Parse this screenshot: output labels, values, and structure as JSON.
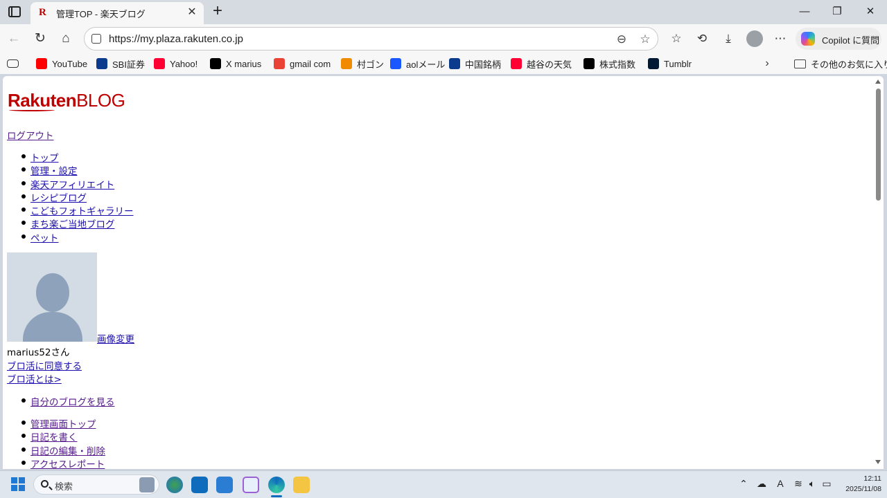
{
  "browser": {
    "tab_title": "管理TOP - 楽天ブログ",
    "tab_favicon": "R",
    "url": "https://my.plaza.rakuten.co.jp",
    "copilot_label": "Copilot に質問"
  },
  "favorites": [
    {
      "label": "YouTube",
      "icon": "youtube-icon",
      "color": "#ff0000"
    },
    {
      "label": "SBI証券",
      "icon": "sbi-icon",
      "color": "#0a3b8c"
    },
    {
      "label": "Yahoo!",
      "icon": "yahoo-icon",
      "color": "#ff0033"
    },
    {
      "label": "X marius",
      "icon": "x-icon",
      "color": "#000000"
    },
    {
      "label": "gmail com",
      "icon": "gmail-icon",
      "color": "#ea4335"
    },
    {
      "label": "村ゴン",
      "icon": "mura-icon",
      "color": "#f08a00"
    },
    {
      "label": "aolメール",
      "icon": "aol-icon",
      "color": "#1a57ff"
    },
    {
      "label": "中国銘柄",
      "icon": "chugoku-icon",
      "color": "#0a3b8c"
    },
    {
      "label": "越谷の天気",
      "icon": "yahoo-icon",
      "color": "#ff0033"
    },
    {
      "label": "株式指数",
      "icon": "b-icon",
      "color": "#000000"
    },
    {
      "label": "Tumblr",
      "icon": "tumblr-icon",
      "color": "#001935"
    }
  ],
  "favorites_folder": "その他のお気に入り",
  "page": {
    "logo_rakuten": "Rakuten",
    "logo_blog": "BLOG",
    "logout": "ログアウト",
    "nav": [
      "トップ",
      "管理・設定",
      "楽天アフィリエイト",
      "レシピブログ",
      "こどもフォトギャラリー",
      "まち楽ご当地ブログ",
      "ペット"
    ],
    "image_change": "画像変更",
    "username": "marius52さん",
    "agree": "ブロ活に同意する",
    "whatis": "ブロ活とは>",
    "my_blog": "自分のブログを見る",
    "admin": [
      "管理画面トップ",
      "日記を書く",
      "日記の編集・削除",
      "アクセスレポート"
    ]
  },
  "taskbar": {
    "search_placeholder": "検索",
    "time": "12:11",
    "date": "2025/11/08"
  }
}
